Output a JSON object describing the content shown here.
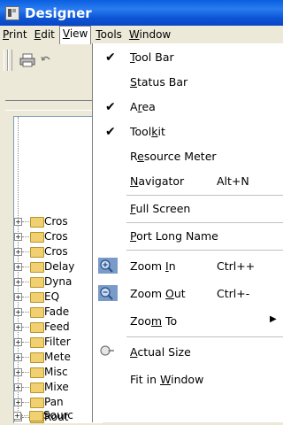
{
  "window": {
    "title": "Designer"
  },
  "menubar": {
    "items": [
      {
        "label": "Print",
        "ul": "P",
        "rest": "rint"
      },
      {
        "label": "Edit",
        "ul": "E",
        "rest": "dit"
      },
      {
        "label": "View",
        "ul": "V",
        "rest": "iew"
      },
      {
        "label": "Tools",
        "ul": "T",
        "rest": "ools"
      },
      {
        "label": "Window",
        "ul": "W",
        "rest": "indow"
      }
    ]
  },
  "tree": {
    "items": [
      "Cros",
      "Cros",
      "Cros",
      "Delay",
      "Dyna",
      "EQ",
      "Fade",
      "Feed",
      "Filter",
      "Mete",
      "Misc",
      "Mixe",
      "Pan",
      "Rout",
      "Sourc"
    ]
  },
  "view_menu": {
    "items": [
      {
        "pre": "",
        "ul": "T",
        "post": "ool Bar",
        "checked": true
      },
      {
        "pre": "",
        "ul": "S",
        "post": "tatus Bar",
        "checked": false
      },
      {
        "pre": "A",
        "ul": "r",
        "post": "ea",
        "checked": true
      },
      {
        "pre": "Tool",
        "ul": "k",
        "post": "it",
        "checked": true
      },
      {
        "pre": "R",
        "ul": "e",
        "post": "source Meter",
        "checked": false
      },
      {
        "pre": "",
        "ul": "N",
        "post": "avigator",
        "shortcut": "Alt+N"
      },
      {
        "pre": "",
        "ul": "F",
        "post": "ull Screen"
      },
      {
        "pre": "",
        "ul": "P",
        "post": "ort Long Name"
      },
      {
        "pre": "Zoom ",
        "ul": "I",
        "post": "n",
        "shortcut": "Ctrl++"
      },
      {
        "pre": "Zoom ",
        "ul": "O",
        "post": "ut",
        "shortcut": "Ctrl+-"
      },
      {
        "pre": "Zoo",
        "ul": "m",
        "post": " To"
      },
      {
        "pre": "",
        "ul": "A",
        "post": "ctual Size"
      },
      {
        "pre": "Fit in ",
        "ul": "W",
        "post": "indow"
      }
    ]
  },
  "colors": {
    "titlebar": "#0a5fe0",
    "menu_bg": "#ffffff",
    "chrome": "#ece9d8",
    "folder": "#f0d070"
  }
}
